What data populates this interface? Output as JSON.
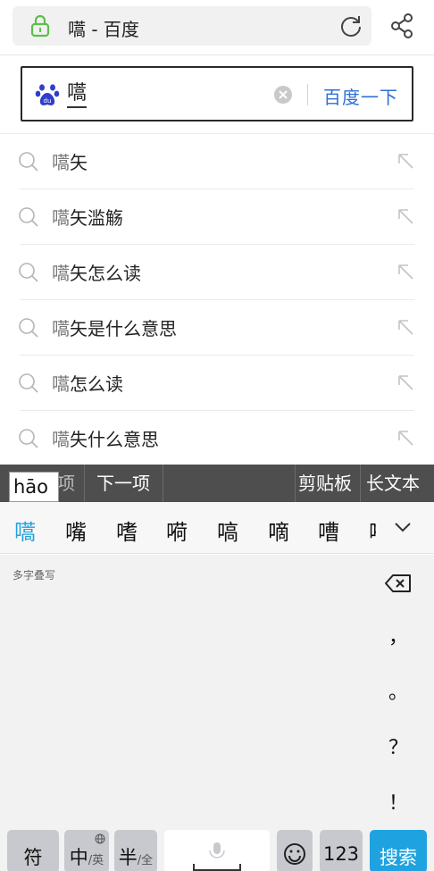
{
  "browser": {
    "address_title": "嚆 - 百度"
  },
  "search": {
    "query": "嚆",
    "submit_label": "百度一下"
  },
  "suggestions": [
    {
      "prefix": "嚆",
      "rest": "矢"
    },
    {
      "prefix": "嚆",
      "rest": "矢滥觞"
    },
    {
      "prefix": "嚆",
      "rest": "矢怎么读"
    },
    {
      "prefix": "嚆",
      "rest": "矢是什么意思"
    },
    {
      "prefix": "嚆",
      "rest": "怎么读"
    },
    {
      "prefix": "嚆",
      "rest": "失什么意思"
    }
  ],
  "keyboard": {
    "pinyin": "hāo",
    "prev_item_partial": "项",
    "next_item": "下一项",
    "clipboard": "剪贴板",
    "long_text": "长文本",
    "candidates": [
      "嚆",
      "嘴",
      "嗜",
      "嗬",
      "嗃",
      "嘀",
      "嘈",
      "嘚"
    ],
    "handwriting_label": "多字叠写",
    "punctuation": [
      "，",
      "。",
      "？",
      "！"
    ],
    "bottom": {
      "symbol_key": "符",
      "lang_key_main": "中",
      "lang_key_sub": "/英",
      "width_key_main": "半",
      "width_key_sub": "/全",
      "num_key": "123",
      "search_key": "搜索"
    }
  },
  "colors": {
    "accent_blue": "#2f6fd6",
    "candidate_highlight": "#21a2dd",
    "search_key": "#1fa3e0",
    "lock_green": "#5cbf4a"
  }
}
